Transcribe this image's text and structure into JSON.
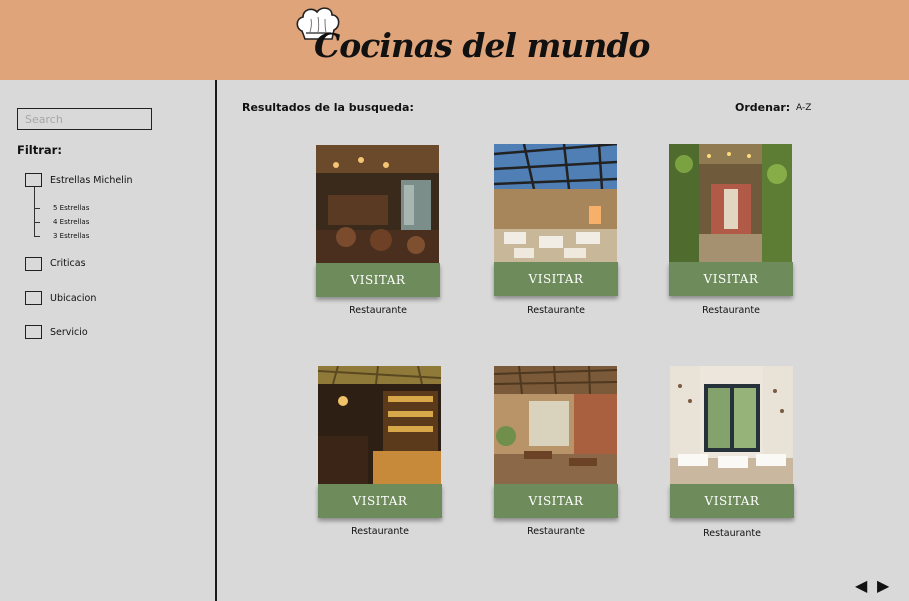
{
  "header": {
    "brand": "Cocinas del mundo",
    "logo_icon": "chef-hat-icon",
    "background": "#e0a47b"
  },
  "sidebar": {
    "search_placeholder": "Search",
    "filter_title": "Filtrar:",
    "filters": [
      {
        "label": "Estrellas Michelin",
        "checked": false
      },
      {
        "label": "Criticas",
        "checked": false
      },
      {
        "label": "Ubicacion",
        "checked": false
      },
      {
        "label": "Servicio",
        "checked": false
      }
    ],
    "michelin_options": [
      "5 Estrellas",
      "4 Estrellas",
      "3 Estrellas"
    ]
  },
  "results": {
    "title": "Resultados de la busqueda:",
    "order_label": "Ordenar:",
    "order_value": "A-Z",
    "button_color": "#6e8b5b",
    "cards": [
      {
        "button": "VISITAR",
        "caption": "Restaurante"
      },
      {
        "button": "VISITAR",
        "caption": "Restaurante"
      },
      {
        "button": "VISITAR",
        "caption": "Restaurante"
      },
      {
        "button": "VISITAR",
        "caption": "Restaurante"
      },
      {
        "button": "VISITAR",
        "caption": "Restaurante"
      },
      {
        "button": "VISITAR",
        "caption": "Restaurante"
      }
    ]
  },
  "pagination": {
    "prev": "◀",
    "next": "▶"
  }
}
